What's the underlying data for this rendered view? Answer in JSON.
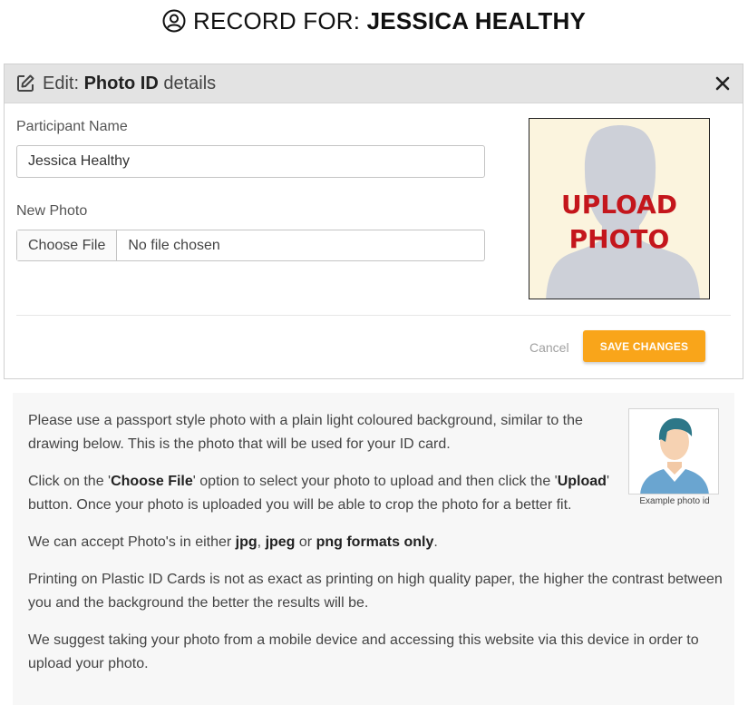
{
  "page_header": {
    "prefix": "RECORD FOR: ",
    "name": "JESSICA HEALTHY",
    "icon": "user-circle-icon"
  },
  "modal": {
    "title_prefix": "Edit: ",
    "title_bold": "Photo ID",
    "title_suffix": " details",
    "edit_icon": "edit-icon",
    "close_icon": "close-icon",
    "participant_label": "Participant Name",
    "participant_value": "Jessica Healthy",
    "photo_label": "New Photo",
    "file_button": "Choose File",
    "file_status": "No file chosen",
    "placeholder_line1": "UPLOAD",
    "placeholder_line2": "PHOTO",
    "cancel_label": "Cancel",
    "save_label": "SAVE CHANGES",
    "colors": {
      "accent": "#f9a51a",
      "upload_text": "#c4161c",
      "placeholder_bg": "#fbf4de"
    }
  },
  "info": {
    "p1": "Please use a passport style photo with a plain light coloured background, similar to the drawing below. This is the photo that will be used for your ID card.",
    "p2_a": "Click on the '",
    "p2_b": "Choose File",
    "p2_c": "' option to select your photo to upload and then click the '",
    "p2_d": "Upload",
    "p2_e": "' button. Once your photo is uploaded you will be able to crop the photo for a better fit.",
    "p3_a": "We can accept Photo's in either ",
    "p3_b": "jpg",
    "p3_c": ", ",
    "p3_d": "jpeg",
    "p3_e": " or ",
    "p3_f": "png formats only",
    "p3_g": ".",
    "p4": "Printing on Plastic ID Cards is not as exact as printing on high quality paper, the higher the contrast between you and the background the better the results will be.",
    "p5": "We suggest taking your photo from a mobile device and accessing this website via this device in order to upload your photo.",
    "example_caption": "Example photo id"
  }
}
